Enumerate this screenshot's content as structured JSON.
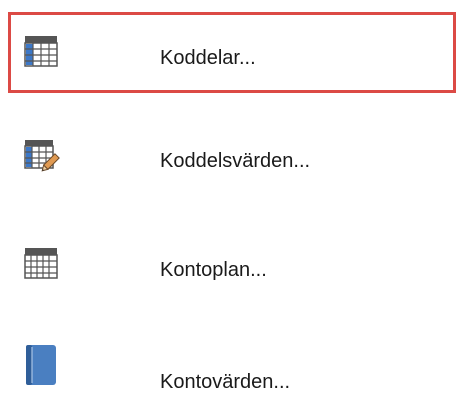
{
  "menu": {
    "items": [
      {
        "label": "Koddelar...",
        "icon": "code-parts-table-icon",
        "selected": true
      },
      {
        "label": "Koddelsvärden...",
        "icon": "code-values-table-edit-icon",
        "selected": false
      },
      {
        "label": "Kontoplan...",
        "icon": "chart-of-accounts-table-icon",
        "selected": false
      },
      {
        "label": "Kontovärden...",
        "icon": "account-values-book-icon",
        "selected": false
      }
    ]
  },
  "colors": {
    "selection_outline": "#dc4a45",
    "icon_blue": "#3c78c8",
    "icon_dark": "#555555",
    "text": "#1a1a1a"
  }
}
